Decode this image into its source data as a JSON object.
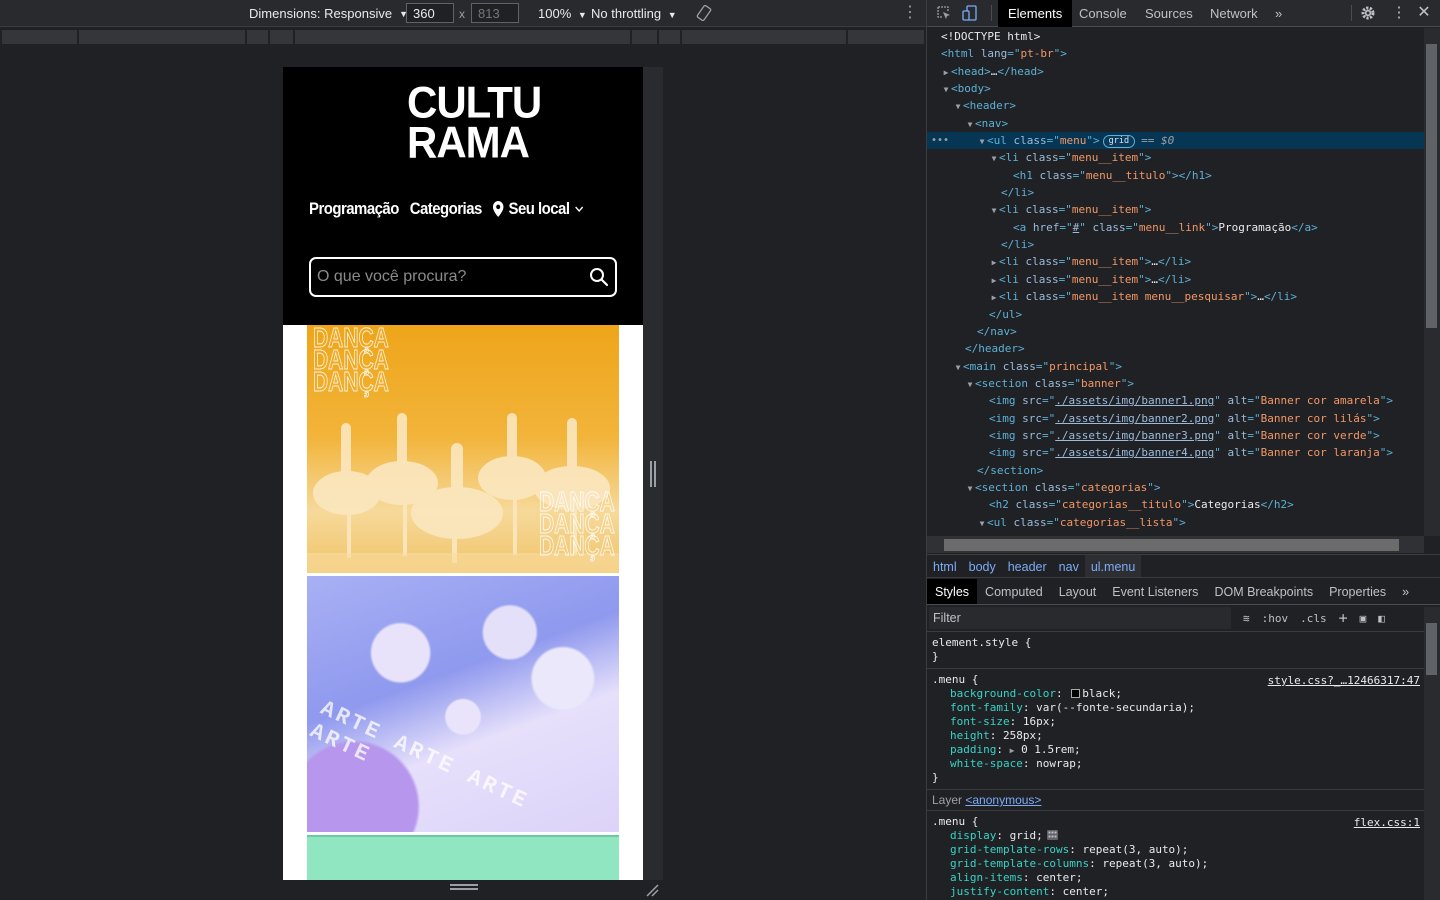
{
  "emulation": {
    "dimensions_label": "Dimensions: Responsive",
    "width": "360",
    "height_placeholder": "813",
    "zoom": "100%",
    "throttling": "No throttling"
  },
  "site": {
    "logo_line1": "CULTU",
    "logo_line2": "RAMA",
    "menu": {
      "programacao": "Programação",
      "categorias": "Categorias",
      "local": "Seu local"
    },
    "search_placeholder": "O que você procura?",
    "banners": [
      {
        "alt": "Banner cor amarela",
        "overlay_text": "DANÇA",
        "color": "#eea51a"
      },
      {
        "alt": "Banner cor lilás",
        "overlay_text": "ARTE",
        "color": "#9aa2f0"
      },
      {
        "alt": "Banner cor verde",
        "color": "#8fe6c1"
      }
    ]
  },
  "devtools": {
    "tabs": [
      "Elements",
      "Console",
      "Sources",
      "Network"
    ],
    "more_tabs": "»",
    "dom": {
      "doctype": "<!DOCTYPE html>",
      "html_lang": "pt-br",
      "menu_class": "menu",
      "grid_badge": "grid",
      "selected_ref": "$0",
      "menu_item_class": "menu__item",
      "menu_titulo_class": "menu__titulo",
      "link_href": "#",
      "link_class": "menu__link",
      "link_text": "Programação",
      "pesquisar_class": "menu__item menu__pesquisar",
      "main_class": "principal",
      "banner_class": "banner",
      "images": [
        {
          "src": "./assets/img/banner1.png",
          "alt": "Banner cor amarela"
        },
        {
          "src": "./assets/img/banner2.png",
          "alt": "Banner cor lilás"
        },
        {
          "src": "./assets/img/banner3.png",
          "alt": "Banner cor verde"
        },
        {
          "src": "./assets/img/banner4.png",
          "alt": "Banner cor laranja"
        }
      ],
      "categorias_class": "categorias",
      "categorias_titulo_class": "categorias__titulo",
      "categorias_titulo_text": "Categorias",
      "categorias_lista_class": "categorias__lista"
    },
    "breadcrumbs": [
      "html",
      "body",
      "header",
      "nav",
      "ul.menu"
    ],
    "subtabs": [
      "Styles",
      "Computed",
      "Layout",
      "Event Listeners",
      "DOM Breakpoints",
      "Properties"
    ],
    "filter_placeholder": "Filter",
    "hov": ":hov",
    "cls": ".cls",
    "styles": {
      "element_style": "element.style {",
      "rule1": {
        "selector": ".menu {",
        "source": "style.css?_…12466317:47",
        "props": [
          {
            "name": "background-color",
            "value": "black;"
          },
          {
            "name": "font-family",
            "value": "var(--fonte-secundaria);"
          },
          {
            "name": "font-size",
            "value": "16px;"
          },
          {
            "name": "height",
            "value": "258px;"
          },
          {
            "name": "padding",
            "value": "0 1.5rem;"
          },
          {
            "name": "white-space",
            "value": "nowrap;"
          }
        ]
      },
      "layer_label": "Layer",
      "layer_name": "<anonymous>",
      "rule2": {
        "selector": ".menu {",
        "source": "flex.css:1",
        "props": [
          {
            "name": "display",
            "value": "grid;"
          },
          {
            "name": "grid-template-rows",
            "value": "repeat(3, auto);"
          },
          {
            "name": "grid-template-columns",
            "value": "repeat(3, auto);"
          },
          {
            "name": "align-items",
            "value": "center;"
          },
          {
            "name": "justify-content",
            "value": "center;"
          }
        ]
      }
    }
  }
}
